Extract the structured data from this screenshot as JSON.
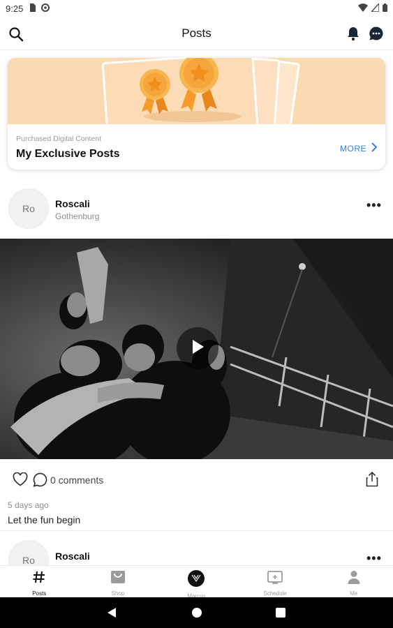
{
  "status_bar": {
    "time": "9:25"
  },
  "header": {
    "title": "Posts"
  },
  "promo": {
    "subtitle": "Purchased Digital Content",
    "title": "My Exclusive Posts",
    "more_label": "MORE"
  },
  "posts": [
    {
      "avatar_initials": "Ro",
      "author": "Roscali",
      "location": "Gothenburg",
      "comments_label": "0 comments",
      "time_ago": "5 days ago",
      "caption": "Let the fun begin"
    },
    {
      "avatar_initials": "Ro",
      "author": "Roscali"
    }
  ],
  "bottom_nav": [
    {
      "label": "Posts",
      "icon": "hash-icon",
      "active": true
    },
    {
      "label": "Shop",
      "icon": "shop-bag-icon",
      "active": false
    },
    {
      "label": "Marcus",
      "icon": "creator-avatar-icon",
      "active": false
    },
    {
      "label": "Schedule",
      "icon": "schedule-icon",
      "active": false
    },
    {
      "label": "Me",
      "icon": "person-icon",
      "active": false
    }
  ],
  "colors": {
    "accent": "#2f80ed",
    "promo_banner": "#fbd9b1",
    "medal": "#f6a53a"
  }
}
